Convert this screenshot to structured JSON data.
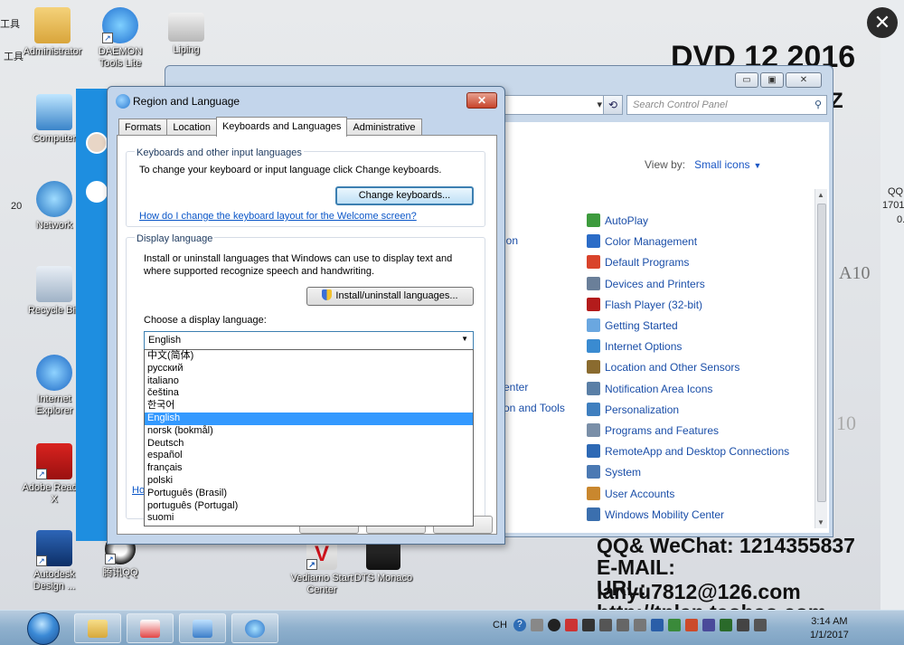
{
  "desktop": {
    "icons": [
      {
        "label": "Administrator"
      },
      {
        "label": "DAEMON Tools Lite"
      },
      {
        "label": "Liping"
      },
      {
        "label": "Computer"
      },
      {
        "label": "Network"
      },
      {
        "label": "Recycle Bin"
      },
      {
        "label": "Internet Explorer"
      },
      {
        "label": "Adobe Reader X"
      },
      {
        "label": "Autodesk Design ..."
      },
      {
        "label": "腾讯QQ"
      },
      {
        "label": "Vediamo Start Center"
      },
      {
        "label": "DTS Monaco"
      }
    ],
    "side_left_text": [
      "工具",
      "20"
    ],
    "side_right_text": [
      "QQ",
      "1701",
      "0."
    ]
  },
  "ads": {
    "dvd": "DVD 12 2016",
    "z": "Z",
    "qq": "QQ& WeChat: 1214355837",
    "email": "E-MAIL: lanyu7812@126.com",
    "url": "URL: http://tnlan.taobao.com",
    "ten": "10",
    "a10": "A10"
  },
  "control_panel": {
    "search_placeholder": "Search Control Panel",
    "view_by_label": "View by:",
    "view_by_value": "Small icons",
    "left_partial_items": [
      "ion",
      "enter",
      "on and Tools"
    ],
    "items": [
      {
        "label": "AutoPlay",
        "color": "#3d9b3d"
      },
      {
        "label": "Color Management",
        "color": "#2b6cc7"
      },
      {
        "label": "Default Programs",
        "color": "#d9432b"
      },
      {
        "label": "Devices and Printers",
        "color": "#6a7f99"
      },
      {
        "label": "Flash Player (32-bit)",
        "color": "#b31b1b"
      },
      {
        "label": "Getting Started",
        "color": "#6aa7e0"
      },
      {
        "label": "Internet Options",
        "color": "#3a8bd1"
      },
      {
        "label": "Location and Other Sensors",
        "color": "#8a6b2f"
      },
      {
        "label": "Notification Area Icons",
        "color": "#5a7fa6"
      },
      {
        "label": "Personalization",
        "color": "#3f7fbf"
      },
      {
        "label": "Programs and Features",
        "color": "#7a8fa8"
      },
      {
        "label": "RemoteApp and Desktop Connections",
        "color": "#2d69b5"
      },
      {
        "label": "System",
        "color": "#4b79b3"
      },
      {
        "label": "User Accounts",
        "color": "#c9872e"
      },
      {
        "label": "Windows Mobility Center",
        "color": "#3b6fae"
      }
    ]
  },
  "dialog": {
    "title": "Region and Language",
    "close_glyph": "✕",
    "tabs": [
      "Formats",
      "Location",
      "Keyboards and Languages",
      "Administrative"
    ],
    "active_tab": "Keyboards and Languages",
    "keyboards_group_title": "Keyboards and other input languages",
    "keyboards_text": "To change your keyboard or input language click Change keyboards.",
    "change_keyboards_button": "Change keyboards...",
    "welcome_link": "How do I change the keyboard layout for the Welcome screen?",
    "display_group_title": "Display language",
    "display_text_1": "Install or uninstall languages that Windows can use to display text and",
    "display_text_2": "where supported recognize speech and handwriting.",
    "install_button": "Install/uninstall languages...",
    "choose_label": "Choose a display language:",
    "selected_language": "English",
    "language_options": [
      "中文(简体)",
      "русский",
      "italiano",
      "čeština",
      "한국어",
      "English",
      "norsk (bokmål)",
      "Deutsch",
      "español",
      "français",
      "polski",
      "Português (Brasil)",
      "português (Portugal)",
      "suomi"
    ],
    "partial_link": "Ho"
  },
  "taskbar": {
    "lang_indicator": "CH",
    "time": "3:14 AM",
    "date": "1/1/2017"
  }
}
